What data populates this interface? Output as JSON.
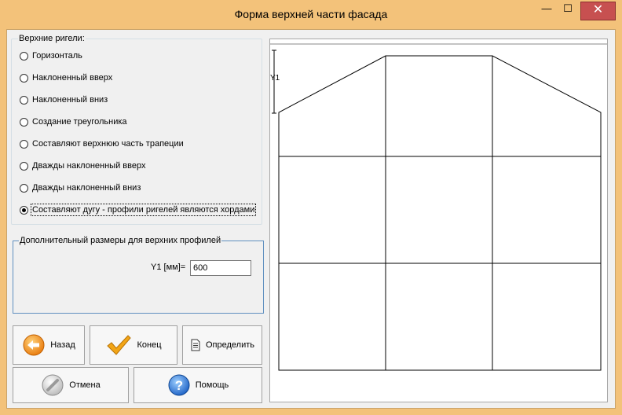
{
  "window": {
    "title": "Форма верхней части фасада",
    "minimize_glyph": "—",
    "maximize_glyph": "☐",
    "close_glyph": "✕"
  },
  "upper_crossbars": {
    "legend": "Верхние ригели:",
    "options": [
      {
        "label": "Горизонталь",
        "checked": false
      },
      {
        "label": "Наклоненный вверх",
        "checked": false
      },
      {
        "label": "Наклоненный вниз",
        "checked": false
      },
      {
        "label": "Создание треугольника",
        "checked": false
      },
      {
        "label": "Составляют верхнюю часть трапеции",
        "checked": false
      },
      {
        "label": "Дважды наклоненный вверх",
        "checked": false
      },
      {
        "label": "Дважды наклоненный вниз",
        "checked": false
      },
      {
        "label": "Составляют дугу - профили ригелей являются хордами",
        "checked": true
      }
    ]
  },
  "additional_sizes": {
    "legend": "Дополнительный размеры для верхних профилей",
    "y1_label": "Y1 [мм]=",
    "y1_value": "600"
  },
  "buttons": {
    "back": {
      "label": "Назад",
      "icon": "arrow-left-icon"
    },
    "finish": {
      "label": "Конец",
      "icon": "checkmark-icon"
    },
    "define": {
      "label": "Определить",
      "icon": "document-icon"
    },
    "cancel": {
      "label": "Отмена",
      "icon": "cancel-disc-icon"
    },
    "help": {
      "label": "Помощь",
      "icon": "help-icon"
    }
  },
  "preview": {
    "dimension_label": "Y1"
  }
}
